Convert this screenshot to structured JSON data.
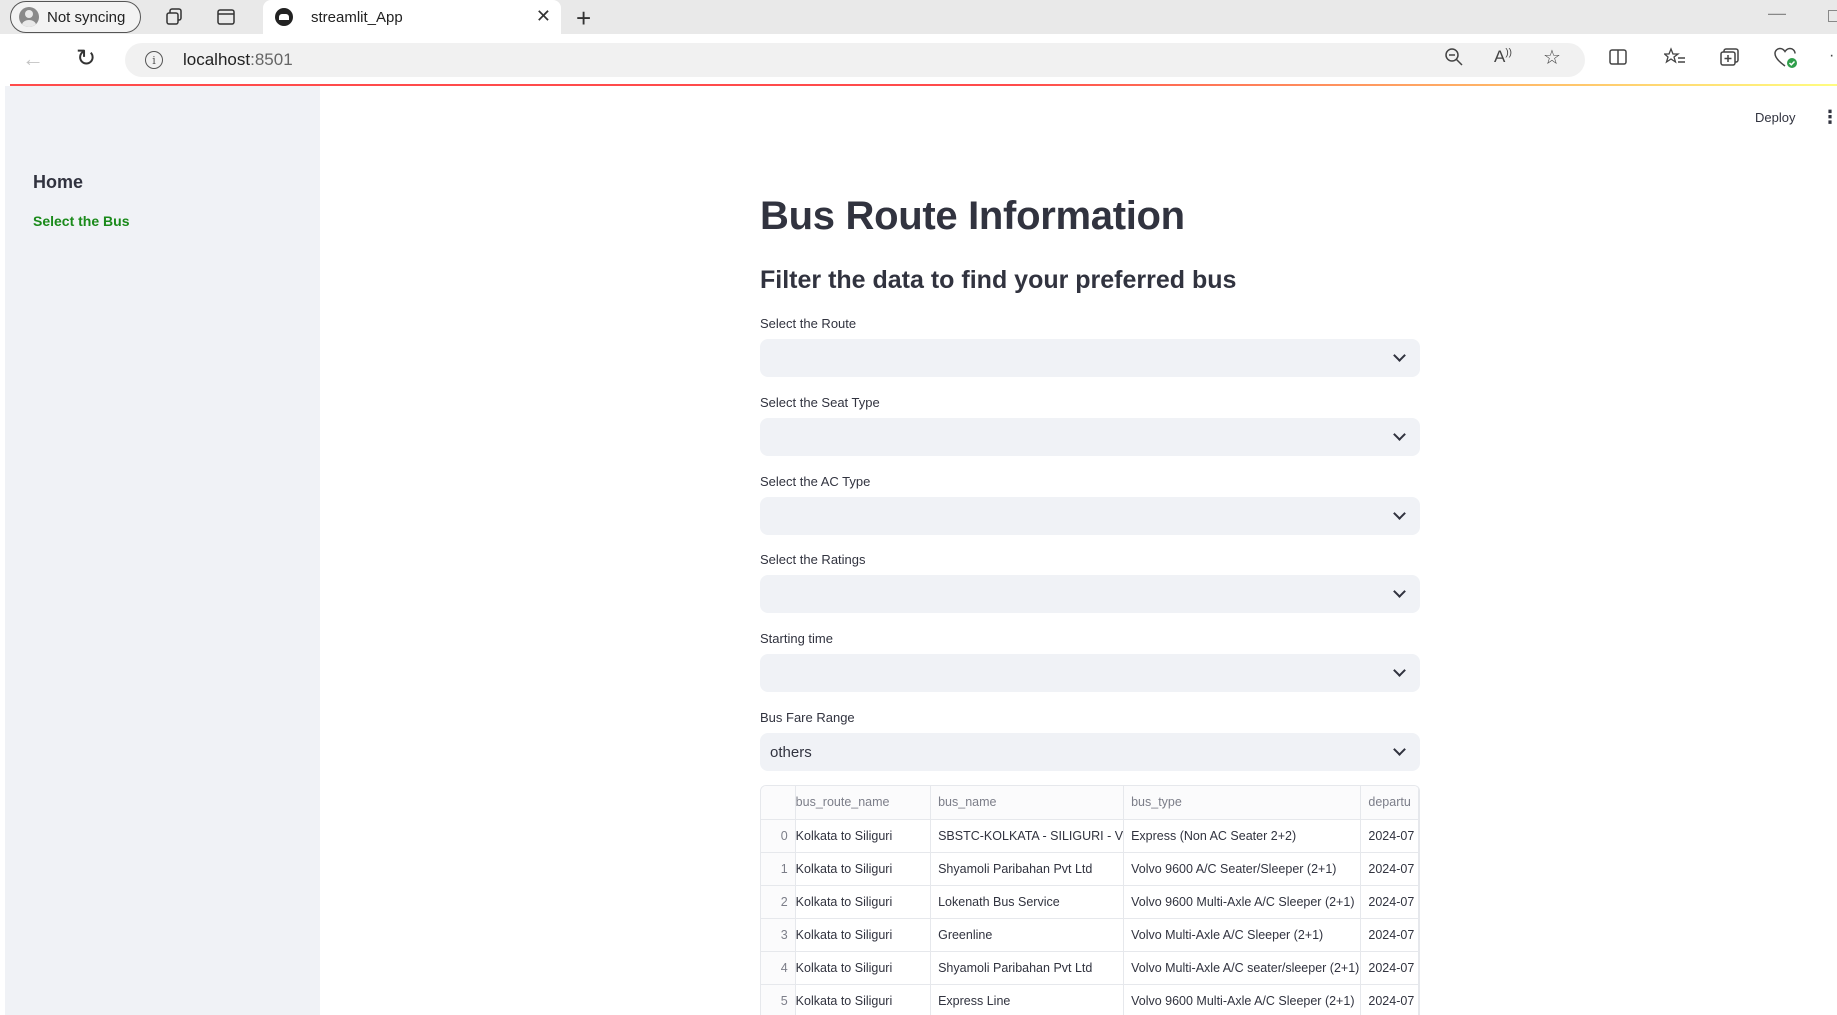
{
  "browser": {
    "profile_label": "Not syncing",
    "tab_title": "streamlit_App",
    "url_host": "localhost",
    "url_port": ":8501",
    "info_glyph": "i"
  },
  "header": {
    "deploy_label": "Deploy",
    "menu_glyph": "⋮"
  },
  "sidebar": {
    "items": [
      {
        "label": "Home",
        "active": false
      },
      {
        "label": "Select the Bus",
        "active": true,
        "color": "#1a8a1a"
      }
    ]
  },
  "main": {
    "title": "Bus Route Information",
    "subtitle": "Filter the data to find your preferred bus",
    "filters": [
      {
        "label": "Select the Route",
        "value": ""
      },
      {
        "label": "Select the Seat Type",
        "value": ""
      },
      {
        "label": "Select the AC Type",
        "value": ""
      },
      {
        "label": "Select the Ratings",
        "value": ""
      },
      {
        "label": "Starting time",
        "value": ""
      },
      {
        "label": "Bus Fare Range",
        "value": "others"
      }
    ]
  },
  "table": {
    "columns": [
      "",
      "bus_route_name",
      "bus_name",
      "bus_type",
      "departu"
    ],
    "rows": [
      [
        "0",
        "Kolkata to Siliguri",
        "SBSTC-KOLKATA - SILIGURI - V",
        "Express (Non AC Seater 2+2)",
        "2024-07"
      ],
      [
        "1",
        "Kolkata to Siliguri",
        "Shyamoli Paribahan Pvt Ltd",
        "Volvo 9600 A/C Seater/Sleeper (2+1)",
        "2024-07"
      ],
      [
        "2",
        "Kolkata to Siliguri",
        "Lokenath Bus Service",
        "Volvo 9600 Multi-Axle A/C Sleeper (2+1)",
        "2024-07"
      ],
      [
        "3",
        "Kolkata to Siliguri",
        "Greenline",
        "Volvo Multi-Axle A/C Sleeper (2+1)",
        "2024-07"
      ],
      [
        "4",
        "Kolkata to Siliguri",
        "Shyamoli Paribahan Pvt Ltd",
        "Volvo Multi-Axle A/C seater/sleeper (2+1)",
        "2024-07"
      ],
      [
        "5",
        "Kolkata to Siliguri",
        "Express Line",
        "Volvo 9600 Multi-Axle A/C Sleeper (2+1)",
        "2024-07"
      ]
    ]
  },
  "colors": {
    "accent": "#ff4b4b",
    "sidebar_bg": "#f0f2f6",
    "active_nav": "#1a8a1a"
  }
}
